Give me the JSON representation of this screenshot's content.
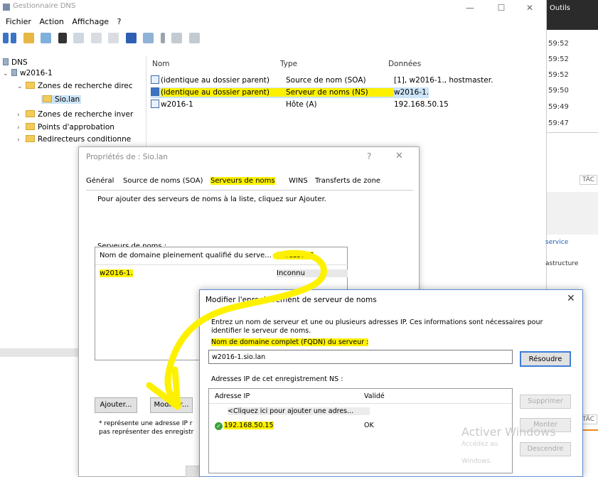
{
  "window": {
    "title": "Gestionnaire DNS",
    "minimize": "—",
    "maximize": "☐",
    "close": "✕"
  },
  "menu": [
    "Fichier",
    "Action",
    "Affichage",
    "?"
  ],
  "tree": {
    "root": "DNS",
    "server": "w2016-1",
    "forward_zones": "Zones de recherche direc",
    "zone": "Sio.lan",
    "reverse_zones": "Zones de recherche inver",
    "trust_points": "Points d'approbation",
    "forwarders": "Redirecteurs conditionne"
  },
  "records": {
    "columns": [
      "Nom",
      "Type",
      "Données"
    ],
    "rows": [
      {
        "name": "(identique au dossier parent)",
        "type": "Source de nom (SOA)",
        "data": "[1], w2016-1., hostmaster."
      },
      {
        "name": "(identique au dossier parent)",
        "type": "Serveur de noms (NS)",
        "data": "w2016-1."
      },
      {
        "name": "w2016-1",
        "type": "Hôte (A)",
        "data": "192.168.50.15"
      }
    ]
  },
  "right_window": {
    "header": "Outils",
    "times": [
      "59:52",
      "59:52",
      "59:52",
      "59:50",
      "59:49",
      "59:47"
    ],
    "tach": "TÂC",
    "service": "service",
    "infra": "astructure",
    "tac2": "TÂC"
  },
  "properties": {
    "title": "Propriétés de : Sio.lan",
    "help": "?",
    "close": "✕",
    "tabs": [
      "Général",
      "Source de noms (SOA)",
      "Serveurs de noms",
      "WINS",
      "Transferts de zone"
    ],
    "info": "Pour ajouter des serveurs de noms à la liste, cliquez sur Ajouter.",
    "list_label": "Serveurs de noms :",
    "list_columns": [
      "Nom de domaine pleinement qualifié du serve...",
      "Adresse IP"
    ],
    "list_rows": [
      {
        "fqdn": "w2016-1.",
        "ip": "Inconnu"
      }
    ],
    "add_button": "Ajouter...",
    "modify_button": "Modifier...",
    "note_line1": "* représente une adresse IP r",
    "note_line2": "pas représenter des enregistr"
  },
  "modify": {
    "title": "Modifier l'enregistrement de serveur de noms",
    "close": "✕",
    "description": "Entrez un nom de serveur et une ou plusieurs adresses IP. Ces informations sont nécessaires pour identifier le serveur de noms.",
    "fqdn_label": "Nom de domaine complet (FQDN) du serveur :",
    "fqdn_value": "w2016-1.sio.lan",
    "resolve_button": "Résoudre",
    "ip_label": "Adresses IP de cet enregistrement NS :",
    "ip_columns": [
      "Adresse IP",
      "Validé"
    ],
    "ip_placeholder": "<Cliquez ici pour ajouter une adres...",
    "ip_rows": [
      {
        "ip": "192.168.50.15",
        "status": "OK"
      }
    ],
    "delete_button": "Supprimer",
    "up_button": "Monter",
    "down_button": "Descendre"
  },
  "watermark": {
    "line1": "Activer Windows",
    "line2": "Accédez au",
    "line3": "Windows."
  },
  "colors": {
    "highlight": "#fdf100",
    "accent": "#3c7fd8",
    "ok": "#3aa23a"
  }
}
